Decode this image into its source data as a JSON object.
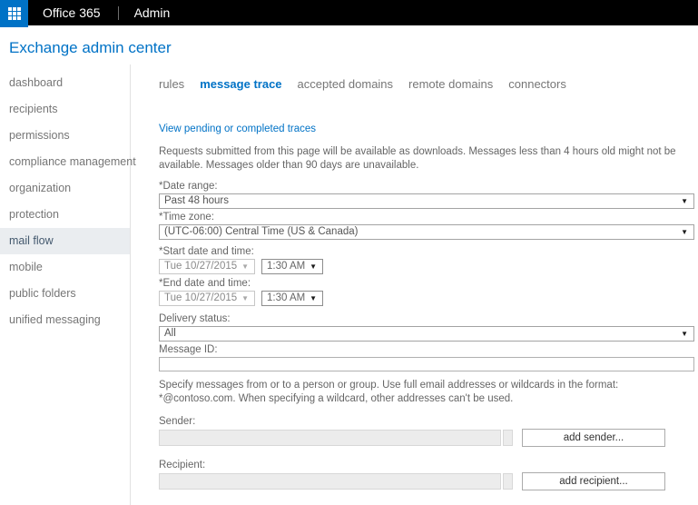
{
  "accent_color": "#0072c6",
  "icons": {
    "caret": "▼"
  },
  "topbar": {
    "app_name": "Office 365",
    "menu": "Admin"
  },
  "header": {
    "title": "Exchange admin center"
  },
  "sidebar": {
    "items": [
      {
        "label": "dashboard",
        "selected": false
      },
      {
        "label": "recipients",
        "selected": false
      },
      {
        "label": "permissions",
        "selected": false
      },
      {
        "label": "compliance management",
        "selected": false
      },
      {
        "label": "organization",
        "selected": false
      },
      {
        "label": "protection",
        "selected": false
      },
      {
        "label": "mail flow",
        "selected": true
      },
      {
        "label": "mobile",
        "selected": false
      },
      {
        "label": "public folders",
        "selected": false
      },
      {
        "label": "unified messaging",
        "selected": false
      }
    ]
  },
  "tabs": [
    {
      "label": "rules",
      "selected": false
    },
    {
      "label": "message trace",
      "selected": true
    },
    {
      "label": "accepted domains",
      "selected": false
    },
    {
      "label": "remote domains",
      "selected": false
    },
    {
      "label": "connectors",
      "selected": false
    }
  ],
  "main": {
    "view_link": "View pending or completed traces",
    "availability_note": "Requests submitted from this page will be available as downloads. Messages less than 4 hours old might not be available. Messages older than 90 days are unavailable.",
    "date_range": {
      "label": "*Date range:",
      "value": "Past 48 hours"
    },
    "time_zone": {
      "label": "*Time zone:",
      "value": "(UTC-06:00) Central Time (US & Canada)"
    },
    "start_datetime": {
      "label": "*Start date and time:",
      "date": "Tue 10/27/2015",
      "time": "1:30 AM"
    },
    "end_datetime": {
      "label": "*End date and time:",
      "date": "Tue 10/27/2015",
      "time": "1:30 AM"
    },
    "delivery_status": {
      "label": "Delivery status:",
      "value": "All"
    },
    "message_id": {
      "label": "Message ID:",
      "value": ""
    },
    "wildcard_note": "Specify messages from or to a person or group. Use full email addresses or wildcards in the format: *@contoso.com. When specifying a wildcard, other addresses can't be used.",
    "sender": {
      "label": "Sender:",
      "value": "",
      "button": "add sender..."
    },
    "recipient": {
      "label": "Recipient:",
      "value": "",
      "button": "add recipient..."
    }
  }
}
